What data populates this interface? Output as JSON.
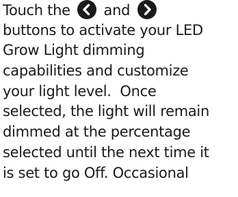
{
  "paragraph": {
    "line1_before": "Touch the",
    "line1_mid": "and",
    "left_button_icon": "chevron-left-circle",
    "right_button_icon": "chevron-right-circle",
    "line2": "buttons to activate your LED",
    "line3": "Grow Light dimming",
    "line4": "capabilities and customize",
    "line5": "your light level.  Once",
    "line6": "selected, the light will remain",
    "line7": "dimmed at the percentage",
    "line8": "selected until the next time it",
    "line9": "is set to go Off. Occasional"
  },
  "colors": {
    "text": "#1a1a1a",
    "background": "#ffffff"
  }
}
